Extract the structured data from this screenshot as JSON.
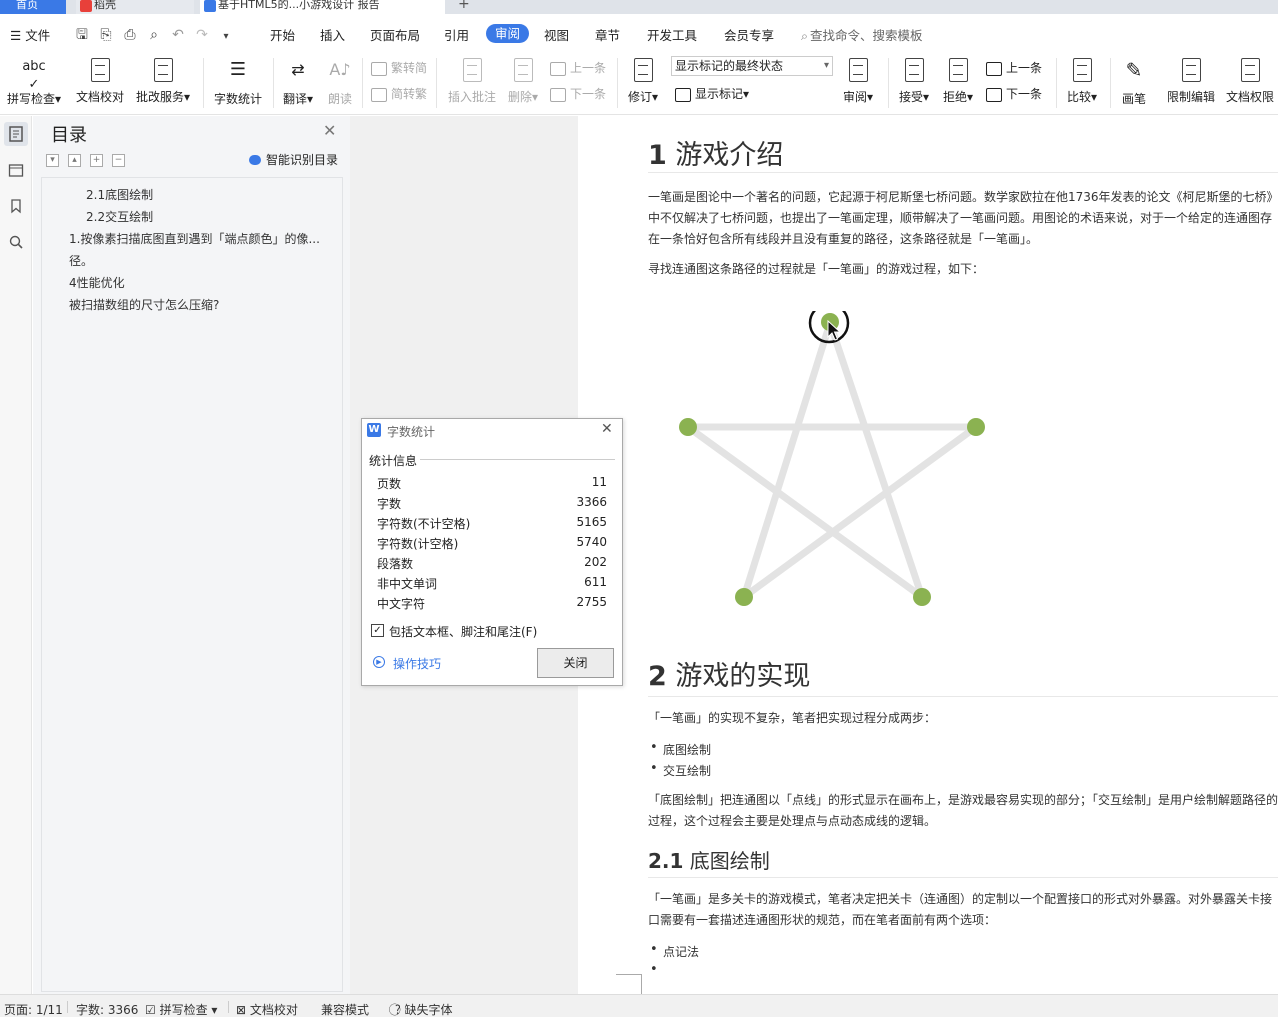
{
  "tabs": {
    "home": "首页",
    "drafts": "稻壳",
    "doc": "基于HTML5的...小游戏设计 报告",
    "add": "+"
  },
  "menu": {
    "file": "文件",
    "items": [
      "开始",
      "插入",
      "页面布局",
      "引用",
      "审阅",
      "视图",
      "章节",
      "开发工具",
      "会员专享"
    ],
    "search": "查找命令、搜索模板"
  },
  "ribbon": {
    "spellcheck": "拼写检查",
    "proofread": "文档校对",
    "correction": "批改服务",
    "wordcount": "字数统计",
    "translate": "翻译",
    "read_aloud": "朗读",
    "to_traditional": "繁转简",
    "to_simplified": "简转繁",
    "insert_comment": "插入批注",
    "delete": "删除",
    "prev_comment": "上一条",
    "next_comment": "下一条",
    "track_changes": "修订",
    "markup_select": "显示标记的最终状态",
    "show_markup": "显示标记",
    "review": "审阅",
    "accept": "接受",
    "reject": "拒绝",
    "prev_change": "上一条",
    "next_change": "下一条",
    "compare": "比较",
    "pen": "画笔",
    "restrict_edit": "限制编辑",
    "doc_permission": "文档权限"
  },
  "toc": {
    "title": "目录",
    "smart": "智能识别目录",
    "items": [
      "2.1底图绘制",
      "2.2交互绘制",
      "1.按像素扫描底图直到遇到「端点颜色」的像...",
      "径。",
      "4性能优化",
      "被扫描数组的尺寸怎么压缩?"
    ]
  },
  "doc": {
    "h1_num": "1",
    "h1_text": "游戏介绍",
    "p1": "一笔画是图论中一个著名的问题，它起源于柯尼斯堡七桥问题。数学家欧拉在他1736年发表的论文《柯尼斯堡的七桥》中不仅解决了七桥问题，也提出了一笔画定理，顺带解决了一笔画问题。用图论的术语来说，对于一个给定的连通图存在一条恰好包含所有线段并且没有重复的路径，这条路径就是「一笔画」。",
    "p2": "寻找连通图这条路径的过程就是「一笔画」的游戏过程，如下：",
    "h2_num": "2",
    "h2_text": "游戏的实现",
    "p3": "「一笔画」的实现不复杂，笔者把实现过程分成两步：",
    "list1": [
      "底图绘制",
      "交互绘制"
    ],
    "p4": "「底图绘制」把连通图以「点线」的形式显示在画布上，是游戏最容易实现的部分；「交互绘制」是用户绘制解题路径的过程，这个过程会主要是处理点与点动态成线的逻辑。",
    "h3_num": "2.1",
    "h3_text": "底图绘制",
    "p5": "「一笔画」是多关卡的游戏模式，笔者决定把关卡（连通图）的定制以一个配置接口的形式对外暴露。对外暴露关卡接口需要有一套描述连通图形状的规范，而在笔者面前有两个选项：",
    "list2": [
      "点记法",
      ""
    ],
    "colors": {
      "node": "#8bb251",
      "edge": "#e3e3e3"
    }
  },
  "dialog": {
    "title": "字数统计",
    "section": "统计信息",
    "rows": [
      {
        "k": "页数",
        "v": "11"
      },
      {
        "k": "字数",
        "v": "3366"
      },
      {
        "k": "字符数(不计空格)",
        "v": "5165"
      },
      {
        "k": "字符数(计空格)",
        "v": "5740"
      },
      {
        "k": "段落数",
        "v": "202"
      },
      {
        "k": "非中文单词",
        "v": "611"
      },
      {
        "k": "中文字符",
        "v": "2755"
      }
    ],
    "include_label": "包括文本框、脚注和尾注(F)",
    "include_checked": true,
    "tips": "操作技巧",
    "close": "关闭"
  },
  "status": {
    "page": "页面: 1/11",
    "words": "字数: 3366",
    "spellcheck": "拼写检查",
    "proofread": "文档校对",
    "compat": "兼容模式",
    "missing_font": "缺失字体"
  },
  "accent": "#3a79e6"
}
